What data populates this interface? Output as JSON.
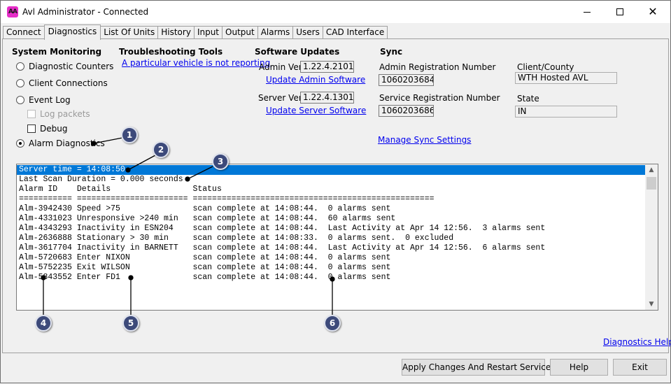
{
  "window": {
    "title": "Avl Administrator - Connected",
    "icon_text": "AA"
  },
  "tabs": [
    {
      "label": "Connect",
      "active": false
    },
    {
      "label": "Diagnostics",
      "active": true
    },
    {
      "label": "List Of Units",
      "active": false
    },
    {
      "label": "History",
      "active": false
    },
    {
      "label": "Input",
      "active": false
    },
    {
      "label": "Output",
      "active": false
    },
    {
      "label": "Alarms",
      "active": false
    },
    {
      "label": "Users",
      "active": false
    },
    {
      "label": "CAD Interface",
      "active": false
    }
  ],
  "system_monitoring": {
    "heading": "System Monitoring",
    "options": [
      {
        "label": "Diagnostic Counters",
        "checked": false
      },
      {
        "label": "Client Connections",
        "checked": false
      },
      {
        "label": "Event Log",
        "checked": false
      }
    ],
    "log_packets_label": "Log packets",
    "debug_label": "Debug",
    "alarm_diagnostics_label": "Alarm Diagnostics"
  },
  "troubleshooting": {
    "heading": "Troubleshooting Tools",
    "link": "A particular vehicle is not reporting"
  },
  "software_updates": {
    "heading": "Software Updates",
    "admin_ver_label": "Admin Ver",
    "admin_ver_value": "1.22.4.2101",
    "update_admin_link": "Update Admin Software",
    "server_ver_label": "Server Ver",
    "server_ver_value": "1.22.4.1301",
    "update_server_link": "Update Server Software"
  },
  "sync": {
    "heading": "Sync",
    "admin_reg_label": "Admin Registration Number",
    "admin_reg_value": "1060203684",
    "service_reg_label": "Service Registration Number",
    "service_reg_value": "1060203686",
    "client_county_label": "Client/County",
    "client_county_value": "WTH Hosted AVL",
    "state_label": "State",
    "state_value": "IN",
    "manage_link": "Manage Sync Settings"
  },
  "log": {
    "lines": [
      "Server time = 14:08:50",
      "Last Scan Duration = 0.000 seconds",
      "Alarm ID    Details                 Status",
      "=========== ======================= ==================================================",
      "Alm-3942430 Speed >75               scan complete at 14:08:44.  0 alarms sent",
      "Alm-4331023 Unresponsive >240 min   scan complete at 14:08:44.  60 alarms sent",
      "Alm-4343293 Inactivity in ESN204    scan complete at 14:08:44.  Last Activity at Apr 14 12:56.  3 alarms sent",
      "Alm-2636888 Stationary > 30 min     scan complete at 14:08:33.  0 alarms sent.  0 excluded",
      "Alm-3617704 Inactivity in BARNETT   scan complete at 14:08:44.  Last Activity at Apr 14 12:56.  6 alarms sent",
      "Alm-5720683 Enter NIXON             scan complete at 14:08:44.  0 alarms sent",
      "Alm-5752235 Exit WILSON             scan complete at 14:08:44.  0 alarms sent",
      "Alm-5843552 Enter FD1               scan complete at 14:08:44.  0 alarms sent"
    ],
    "selected_index": 0
  },
  "footer": {
    "help_link": "Diagnostics Help",
    "apply_button": "Apply Changes And Restart Service",
    "help_button": "Help",
    "exit_button": "Exit"
  },
  "callouts": [
    "1",
    "2",
    "3",
    "4",
    "5",
    "6"
  ],
  "colors": {
    "callout_fill": "#3d4a7a",
    "selection": "#0078d7",
    "link": "#0000ee"
  }
}
